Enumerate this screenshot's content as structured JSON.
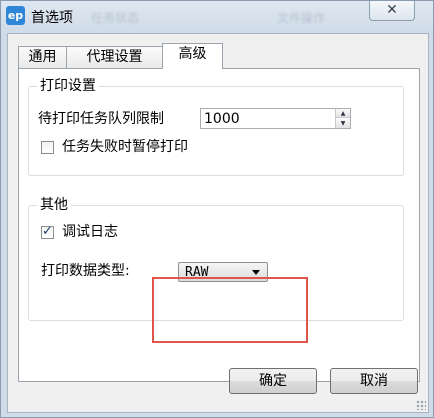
{
  "window": {
    "title": "首选项",
    "app_icon": "ep-logo-icon",
    "close_glyph": "✕",
    "background_titles": [
      "任务状态",
      "文件操作"
    ]
  },
  "tabs": [
    {
      "label": "通用",
      "active": false
    },
    {
      "label": "代理设置",
      "active": false
    },
    {
      "label": "高级",
      "active": true
    }
  ],
  "print_settings": {
    "group_title": "打印设置",
    "queue_limit_label": "待打印任务队列限制",
    "queue_limit_value": "1000",
    "pause_on_failure_label": "任务失败时暂停打印",
    "pause_on_failure_checked": false
  },
  "other": {
    "group_title": "其他",
    "debug_log_label": "调试日志",
    "debug_log_checked": true,
    "data_type_label": "打印数据类型:",
    "data_type_value": "RAW"
  },
  "buttons": {
    "ok": "确定",
    "cancel": "取消"
  },
  "colors": {
    "highlight": "#e0554c",
    "accent": "#2f86d6"
  }
}
